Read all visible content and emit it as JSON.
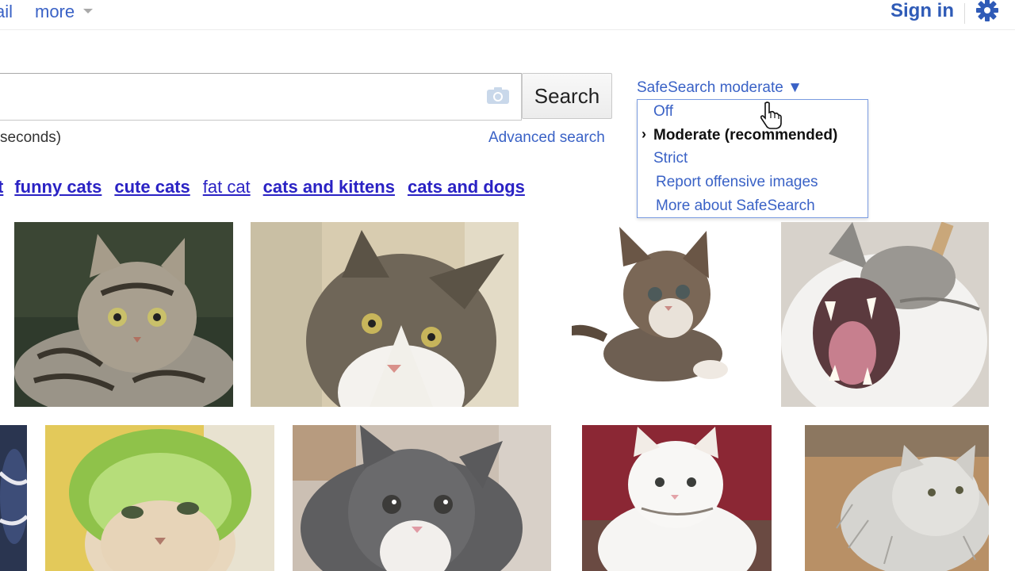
{
  "topbar": {
    "mail_label": "ail",
    "more_label": "more",
    "signin_label": "Sign in",
    "settings_icon": "gear-icon"
  },
  "search": {
    "query_value": "",
    "camera_icon": "camera-icon",
    "button_label": "Search",
    "result_stats": "seconds)",
    "advanced_label": "Advanced search"
  },
  "related": {
    "items": [
      {
        "label": "t"
      },
      {
        "label": "funny cats"
      },
      {
        "label": "cute cats"
      },
      {
        "label": "fat cat"
      },
      {
        "label": "cats and kittens"
      },
      {
        "label": "cats and dogs"
      }
    ]
  },
  "safesearch": {
    "toggle_label": "SafeSearch moderate ▼",
    "selected_marker": "›",
    "options": [
      {
        "label": "Off"
      },
      {
        "label": "Moderate (recommended)"
      },
      {
        "label": "Strict"
      },
      {
        "label": "Report offensive images"
      },
      {
        "label": "More about SafeSearch"
      }
    ]
  },
  "colors": {
    "link": "#3a62c6",
    "related_link": "#2a22c4",
    "menu_border": "#7a9be0"
  }
}
